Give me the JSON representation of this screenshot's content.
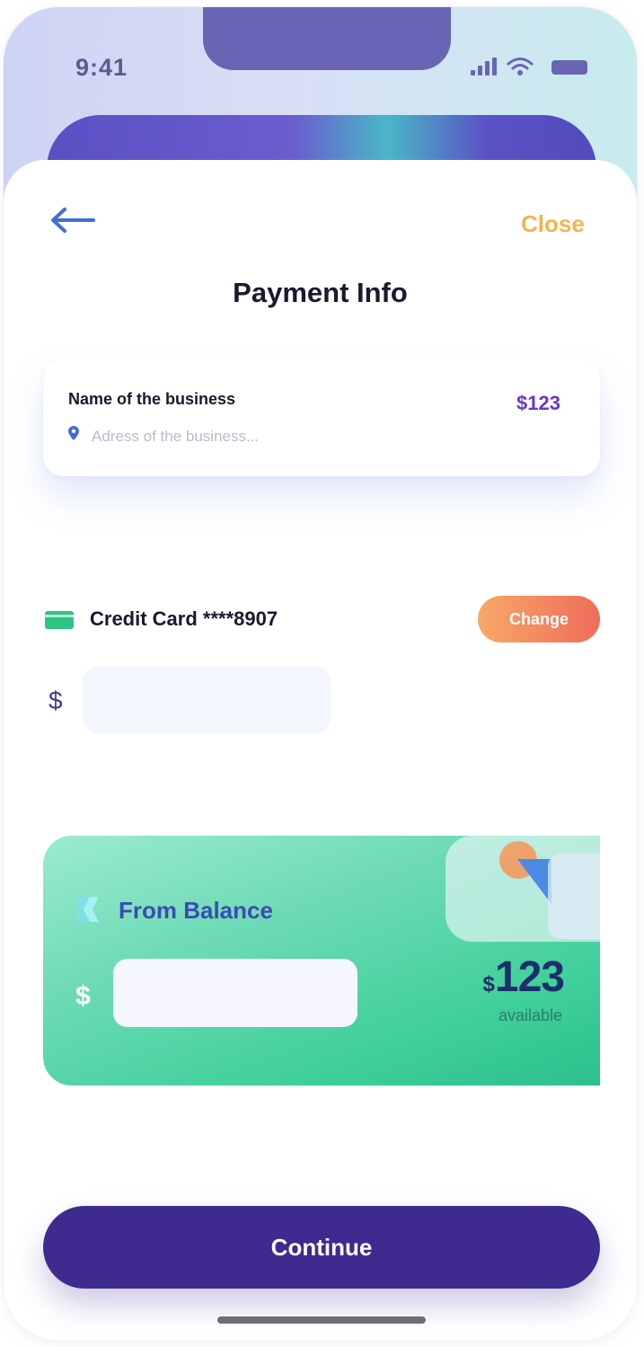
{
  "status_bar": {
    "time": "9:41",
    "icons": [
      "signal-icon",
      "wifi-icon",
      "battery-icon"
    ]
  },
  "header": {
    "back_icon": "arrow-left-icon",
    "close_label": "Close",
    "title": "Payment Info"
  },
  "business": {
    "name": "Name of the business",
    "amount": "$123",
    "address": "Adress of the business...",
    "location_icon": "location-pin-icon"
  },
  "credit_card": {
    "icon": "credit-card-icon",
    "label": "Credit Card ****8907",
    "change_label": "Change",
    "currency": "$",
    "amount_value": ""
  },
  "balance": {
    "icon": "balance-logo-icon",
    "title": "From Balance",
    "currency": "$",
    "amount_value": "",
    "available_currency": "$",
    "available_amount": "123",
    "available_label": "available"
  },
  "footer": {
    "continue_label": "Continue"
  },
  "colors": {
    "primary": "#3f2a8f",
    "accent_orange": "#f2b44f",
    "business_amount": "#6b38c7",
    "balance_green": "#3fcf9a",
    "change_gradient_start": "#f7a766",
    "change_gradient_end": "#ef6d5a"
  }
}
